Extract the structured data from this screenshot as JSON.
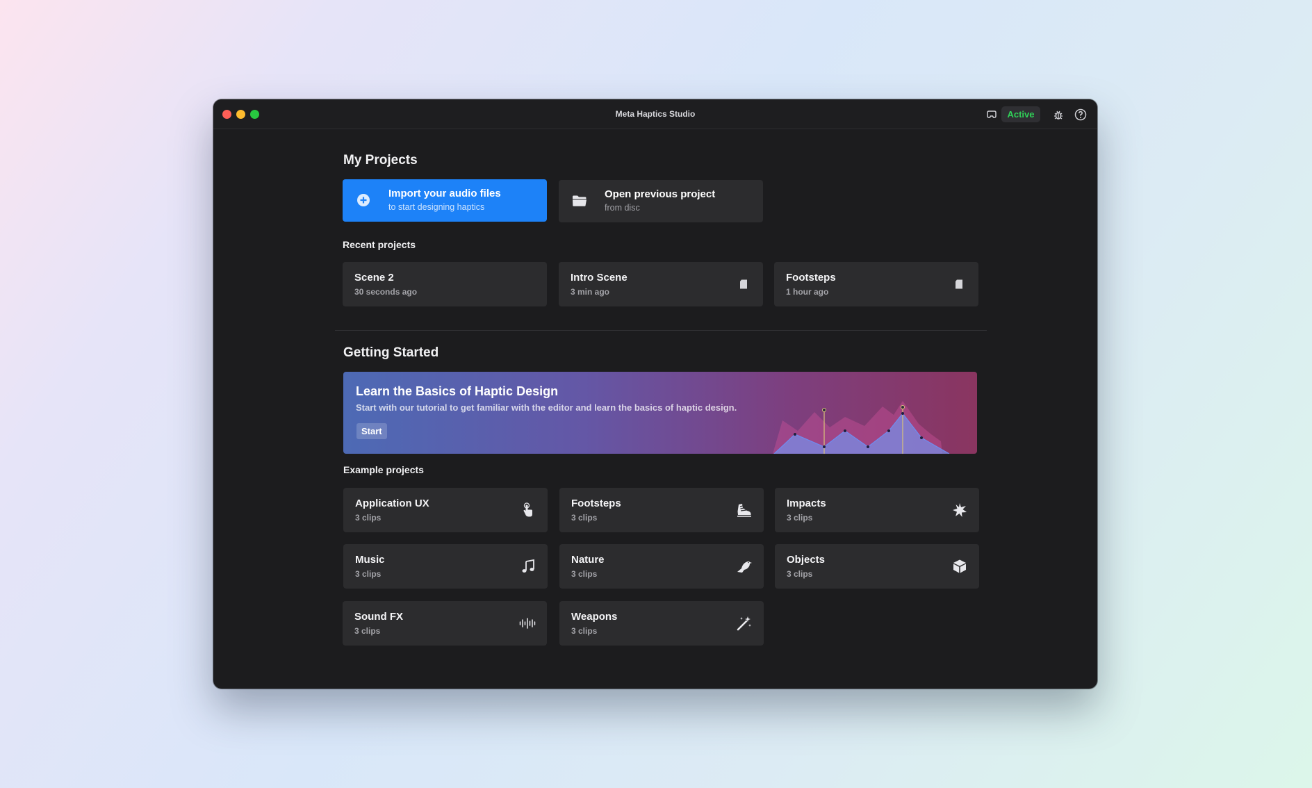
{
  "window": {
    "title": "Meta Haptics Studio"
  },
  "toolbar": {
    "status": "Active",
    "icons": [
      "headset-icon",
      "bug-icon",
      "help-icon"
    ],
    "status_color": "#30d158"
  },
  "my_projects": {
    "heading": "My Projects",
    "import": {
      "title": "Import your audio files",
      "subtitle": "to start designing haptics"
    },
    "open": {
      "title": "Open previous project",
      "subtitle": "from disc"
    }
  },
  "recent": {
    "heading": "Recent projects",
    "items": [
      {
        "title": "Scene 2",
        "time": "30 seconds ago"
      },
      {
        "title": "Intro Scene",
        "time": "3 min ago",
        "icon": "file-icon"
      },
      {
        "title": "Footsteps",
        "time": "1 hour ago",
        "icon": "file-icon"
      }
    ]
  },
  "getting_started": {
    "heading": "Getting Started",
    "banner": {
      "title": "Learn the Basics of Haptic Design",
      "text": "Start with our tutorial to get familiar with the editor and learn the basics of haptic design.",
      "button": "Start"
    }
  },
  "examples": {
    "heading": "Example projects",
    "items": [
      {
        "title": "Application UX",
        "clips": "3 clips",
        "icon": "hand-tap-icon"
      },
      {
        "title": "Footsteps",
        "clips": "3 clips",
        "icon": "shoe-icon"
      },
      {
        "title": "Impacts",
        "clips": "3 clips",
        "icon": "burst-icon"
      },
      {
        "title": "Music",
        "clips": "3 clips",
        "icon": "music-note-icon"
      },
      {
        "title": "Nature",
        "clips": "3 clips",
        "icon": "bird-icon"
      },
      {
        "title": "Objects",
        "clips": "3 clips",
        "icon": "cube-icon"
      },
      {
        "title": "Sound FX",
        "clips": "3 clips",
        "icon": "waveform-icon"
      },
      {
        "title": "Weapons",
        "clips": "3 clips",
        "icon": "magic-wand-icon"
      }
    ]
  },
  "colors": {
    "accent": "#1d82f8",
    "card": "#2c2c2e",
    "window": "#1c1c1e"
  }
}
